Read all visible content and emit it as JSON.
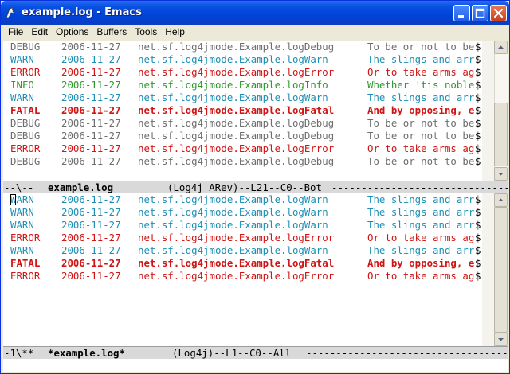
{
  "window": {
    "title": "example.log - Emacs",
    "buttons": [
      "minimize",
      "maximize",
      "close"
    ]
  },
  "menu": [
    "File",
    "Edit",
    "Options",
    "Buffers",
    "Tools",
    "Help"
  ],
  "colors": {
    "DEBUG": "#6e6e6e",
    "WARN": "#1e8fb4",
    "ERROR": "#d11414",
    "INFO": "#2b9a2b",
    "FATAL": "#d11414"
  },
  "top_pane": {
    "lines": [
      {
        "level": "DEBUG",
        "date": "2006-11-27",
        "logger": "net.sf.log4jmode.Example.logDebug",
        "message": "To be or not to be"
      },
      {
        "level": "WARN",
        "date": "2006-11-27",
        "logger": "net.sf.log4jmode.Example.logWarn",
        "message": "The slings and arr"
      },
      {
        "level": "ERROR",
        "date": "2006-11-27",
        "logger": "net.sf.log4jmode.Example.logError",
        "message": "Or to take arms ag"
      },
      {
        "level": "INFO",
        "date": "2006-11-27",
        "logger": "net.sf.log4jmode.Example.logInfo",
        "message": "Whether 'tis noble"
      },
      {
        "level": "WARN",
        "date": "2006-11-27",
        "logger": "net.sf.log4jmode.Example.logWarn",
        "message": "The slings and arr"
      },
      {
        "level": "FATAL",
        "date": "2006-11-27",
        "logger": "net.sf.log4jmode.Example.logFatal",
        "message": "And by opposing, e"
      },
      {
        "level": "DEBUG",
        "date": "2006-11-27",
        "logger": "net.sf.log4jmode.Example.logDebug",
        "message": "To be or not to be"
      },
      {
        "level": "DEBUG",
        "date": "2006-11-27",
        "logger": "net.sf.log4jmode.Example.logDebug",
        "message": "To be or not to be"
      },
      {
        "level": "ERROR",
        "date": "2006-11-27",
        "logger": "net.sf.log4jmode.Example.logError",
        "message": "Or to take arms ag"
      },
      {
        "level": "DEBUG",
        "date": "2006-11-27",
        "logger": "net.sf.log4jmode.Example.logDebug",
        "message": "To be or not to be"
      }
    ]
  },
  "top_modeline": {
    "status": "--\\--",
    "buffer": "example.log",
    "modes": "(Log4j ARev)--L21--C0--Bot",
    "fill": "------------------------------------------------------------"
  },
  "bottom_pane": {
    "lines": [
      {
        "level": "WARN",
        "date": "2006-11-27",
        "logger": "net.sf.log4jmode.Example.logWarn",
        "message": "The slings and arr"
      },
      {
        "level": "WARN",
        "date": "2006-11-27",
        "logger": "net.sf.log4jmode.Example.logWarn",
        "message": "The slings and arr"
      },
      {
        "level": "WARN",
        "date": "2006-11-27",
        "logger": "net.sf.log4jmode.Example.logWarn",
        "message": "The slings and arr"
      },
      {
        "level": "ERROR",
        "date": "2006-11-27",
        "logger": "net.sf.log4jmode.Example.logError",
        "message": "Or to take arms ag"
      },
      {
        "level": "WARN",
        "date": "2006-11-27",
        "logger": "net.sf.log4jmode.Example.logWarn",
        "message": "The slings and arr"
      },
      {
        "level": "FATAL",
        "date": "2006-11-27",
        "logger": "net.sf.log4jmode.Example.logFatal",
        "message": "And by opposing, e"
      },
      {
        "level": "ERROR",
        "date": "2006-11-27",
        "logger": "net.sf.log4jmode.Example.logError",
        "message": "Or to take arms ag"
      }
    ]
  },
  "bottom_modeline": {
    "status": "-1\\**",
    "buffer": "*example.log*",
    "modes": "(Log4j)--L1--C0--All",
    "fill": "------------------------------------------------------------"
  },
  "truncation_mark": "$"
}
